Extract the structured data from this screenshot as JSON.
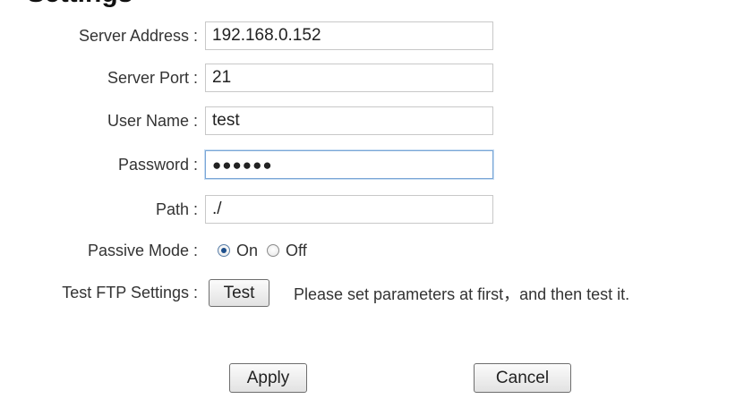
{
  "header": {
    "title_fragment": "Settings"
  },
  "form": {
    "server_address": {
      "label": "Server Address :",
      "value": "192.168.0.152"
    },
    "server_port": {
      "label": "Server Port :",
      "value": "21"
    },
    "user_name": {
      "label": "User Name :",
      "value": "test"
    },
    "password": {
      "label": "Password :",
      "value": "●●●●●●"
    },
    "path": {
      "label": "Path :",
      "value": "./"
    },
    "passive_mode": {
      "label": "Passive Mode :",
      "options": [
        "On",
        "Off"
      ],
      "selected": "On"
    },
    "test_ftp": {
      "label": "Test FTP Settings :",
      "button_label": "Test",
      "hint": "Please set parameters at first，and then test it."
    }
  },
  "actions": {
    "apply_label": "Apply",
    "cancel_label": "Cancel"
  },
  "colors": {
    "focus_border": "#7aa6d6",
    "radio_selected": "#1d4f8c"
  }
}
